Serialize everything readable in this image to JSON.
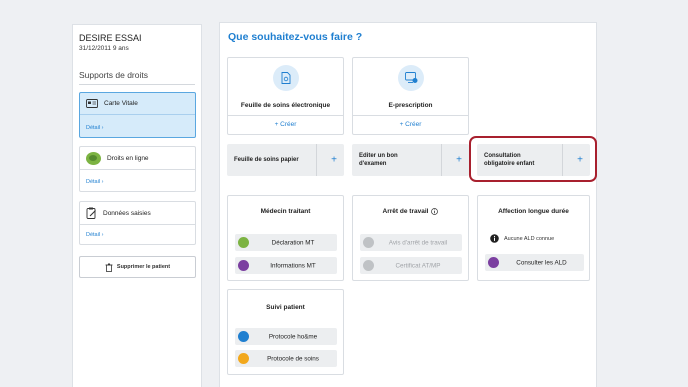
{
  "patient": {
    "name": "DESIRE ESSAI",
    "dob_age": "31/12/2011 9 ans"
  },
  "sidebar": {
    "title": "Supports de droits",
    "cards": [
      {
        "label": "Carte Vitale",
        "detail": "Détail",
        "icon": "card-icon"
      },
      {
        "label": "Droits en ligne",
        "detail": "Détail",
        "icon": "online-rights-icon"
      },
      {
        "label": "Données saisies",
        "detail": "Détail",
        "icon": "clipboard-icon"
      }
    ],
    "delete_button": "Supprimer le patient"
  },
  "main": {
    "title": "Que souhaitez-vous faire ?",
    "action_cards": [
      {
        "label": "Feuille de soins électronique",
        "action": "+ Créer",
        "icon": "document-icon"
      },
      {
        "label": "E-prescription",
        "action": "+ Créer",
        "icon": "prescription-icon"
      }
    ],
    "quick_buttons": [
      {
        "label": "Feuille de soins papier",
        "plus": "+"
      },
      {
        "label_l1": "Editer un bon",
        "label_l2": "d'examen",
        "plus": "+"
      },
      {
        "label_l1": "Consultation",
        "label_l2": "obligatoire enfant",
        "plus": "+"
      }
    ],
    "medecin": {
      "title": "Médecin traitant",
      "items": [
        "Déclaration MT",
        "Informations MT"
      ]
    },
    "arret": {
      "title": "Arrêt de travail",
      "items": [
        "Avis d'arrêt de travail",
        "Certificat AT/MP"
      ]
    },
    "ald": {
      "title": "Affection longue durée",
      "info": "Aucune ALD connue",
      "items": [
        "Consulter les ALD"
      ]
    },
    "suivi": {
      "title": "Suivi patient",
      "items": [
        "Protocole ho&me",
        "Protocole de soins"
      ]
    }
  },
  "colors": {
    "accent": "#1f7fd0",
    "highlight": "#a8202e",
    "active_card": "#d6ebfa"
  }
}
